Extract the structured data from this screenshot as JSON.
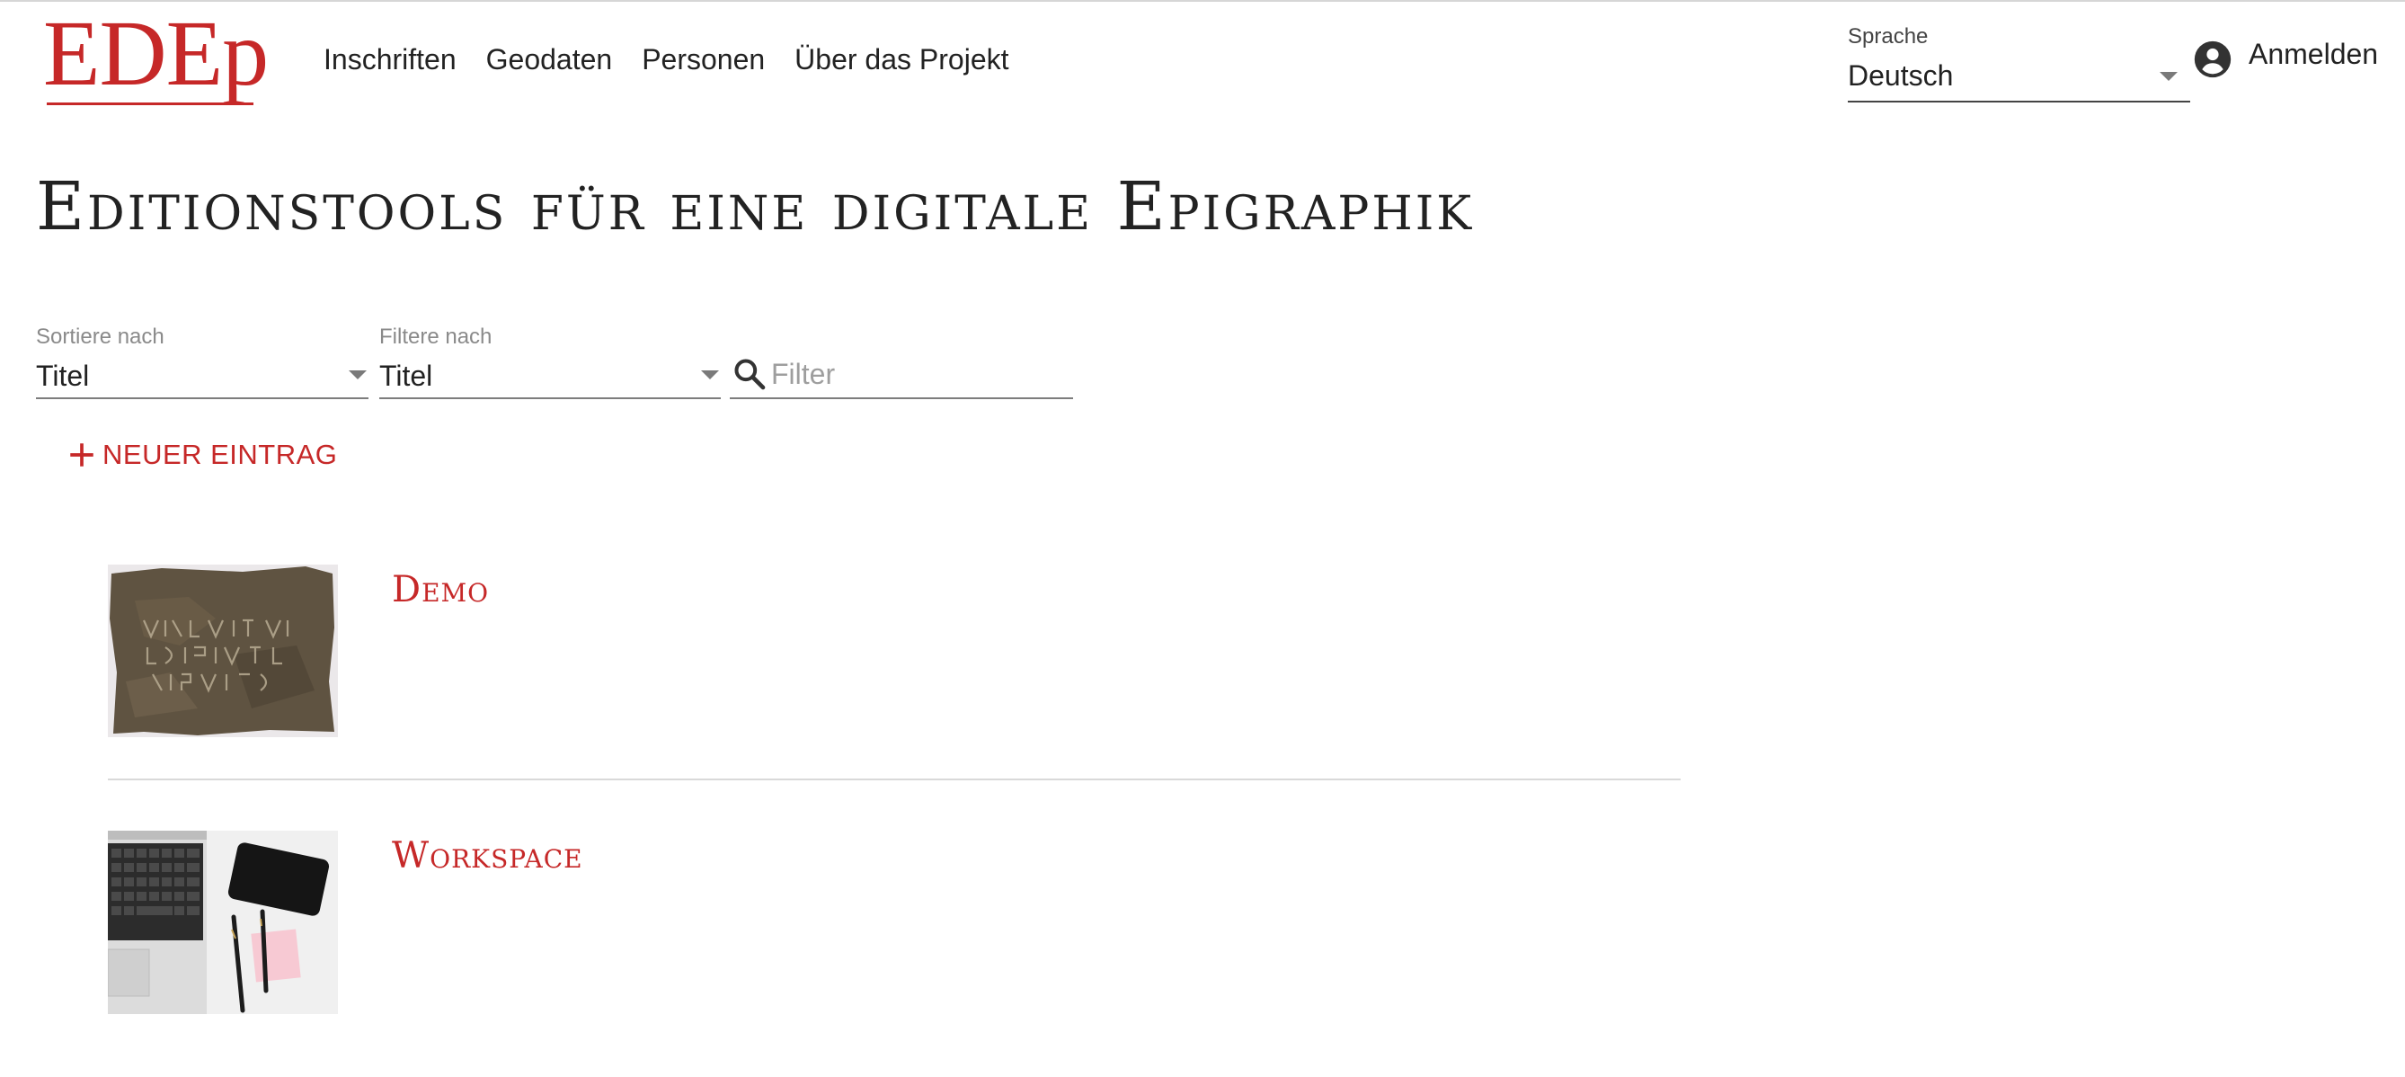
{
  "header": {
    "logo_text": "EDEp",
    "nav": [
      "Inschriften",
      "Geodaten",
      "Personen",
      "Über das Projekt"
    ],
    "language": {
      "label": "Sprache",
      "value": "Deutsch"
    },
    "login_label": "Anmelden"
  },
  "main": {
    "title": "Editionstools für eine digitale Epigraphik",
    "sort": {
      "label": "Sortiere nach",
      "value": "Titel"
    },
    "filter_by": {
      "label": "Filtere nach",
      "value": "Titel"
    },
    "search": {
      "placeholder": "Filter",
      "value": ""
    },
    "new_entry_label": "NEUER EINTRAG",
    "entries": [
      {
        "title": "Demo"
      },
      {
        "title": "Workspace"
      }
    ]
  },
  "colors": {
    "accent": "#c62828",
    "text": "#222222",
    "label": "#8a8a8a",
    "divider": "#d9d9d9"
  }
}
